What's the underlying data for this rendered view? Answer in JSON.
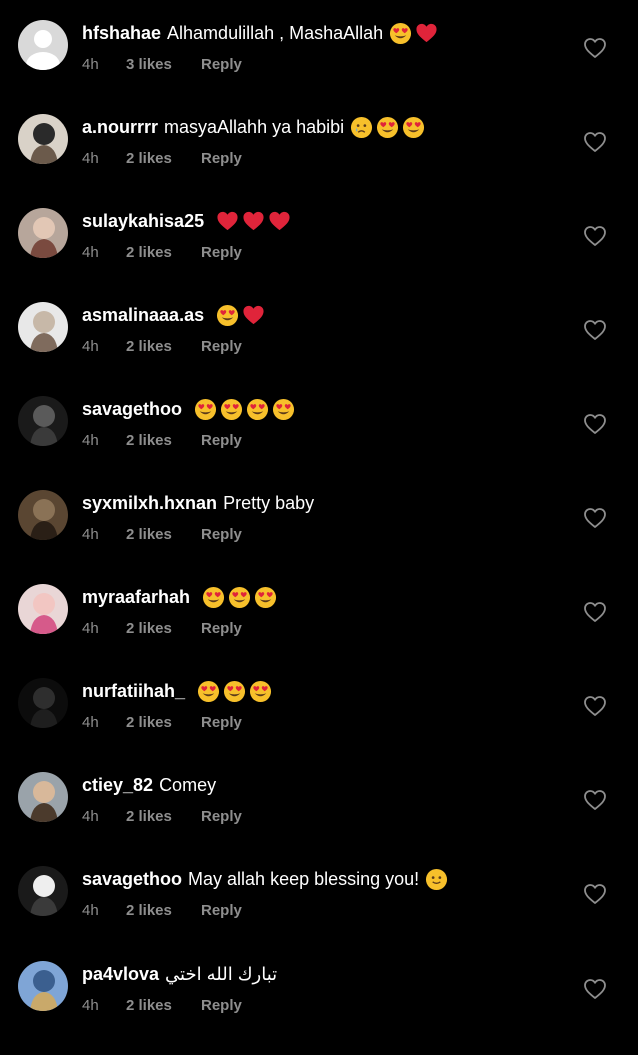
{
  "colors": {
    "background": "#000000",
    "text": "#ffffff",
    "muted": "#8e8e8e",
    "heart_emoji": "#e0243a",
    "face_emoji": "#f7c02b"
  },
  "comments": [
    {
      "username": "hfshahae",
      "text": "Alhamdulillah , MashaAllah",
      "emojis": [
        "heart-eyes",
        "red-heart"
      ],
      "time": "4h",
      "likes": "3 likes",
      "reply": "Reply"
    },
    {
      "username": "a.nourrrr",
      "text": "masyaAllahh ya habibi",
      "emojis": [
        "crying-face",
        "heart-eyes",
        "heart-eyes"
      ],
      "time": "4h",
      "likes": "2 likes",
      "reply": "Reply"
    },
    {
      "username": "sulaykahisa25",
      "text": "",
      "emojis": [
        "red-heart",
        "red-heart",
        "red-heart"
      ],
      "time": "4h",
      "likes": "2 likes",
      "reply": "Reply"
    },
    {
      "username": "asmalinaaa.as",
      "text": "",
      "emojis": [
        "heart-eyes",
        "red-heart"
      ],
      "time": "4h",
      "likes": "2 likes",
      "reply": "Reply"
    },
    {
      "username": "savagethoo",
      "text": "",
      "emojis": [
        "heart-eyes",
        "heart-eyes",
        "heart-eyes",
        "heart-eyes"
      ],
      "time": "4h",
      "likes": "2 likes",
      "reply": "Reply"
    },
    {
      "username": "syxmilxh.hxnan",
      "text": "Pretty baby",
      "emojis": [],
      "time": "4h",
      "likes": "2 likes",
      "reply": "Reply"
    },
    {
      "username": "myraafarhah",
      "text": "",
      "emojis": [
        "heart-eyes",
        "heart-eyes",
        "heart-eyes"
      ],
      "time": "4h",
      "likes": "2 likes",
      "reply": "Reply"
    },
    {
      "username": "nurfatiihah_",
      "text": "",
      "emojis": [
        "heart-eyes",
        "heart-eyes",
        "heart-eyes"
      ],
      "time": "4h",
      "likes": "2 likes",
      "reply": "Reply"
    },
    {
      "username": "ctiey_82",
      "text": "Comey",
      "emojis": [],
      "time": "4h",
      "likes": "2 likes",
      "reply": "Reply"
    },
    {
      "username": "savagethoo",
      "text": "May allah keep blessing you!",
      "emojis": [
        "slight-smile"
      ],
      "time": "4h",
      "likes": "2 likes",
      "reply": "Reply"
    },
    {
      "username": "pa4vlova",
      "text": "تبارك الله اختي",
      "emojis": [],
      "time": "4h",
      "likes": "2 likes",
      "reply": "Reply"
    }
  ]
}
